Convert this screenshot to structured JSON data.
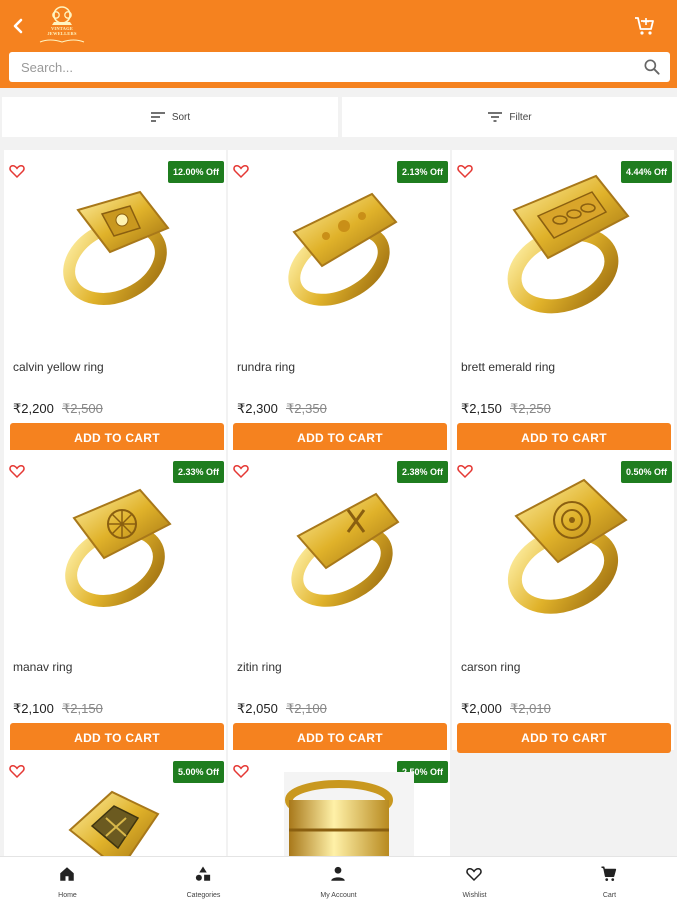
{
  "app": {
    "logo_text": [
      "VINTAGE",
      "JEWELLERS"
    ]
  },
  "search": {
    "placeholder": "Search..."
  },
  "toolbar": {
    "sort_label": "Sort",
    "filter_label": "Filter"
  },
  "colors": {
    "primary": "#f5821f",
    "discount_badge": "#1f7d1f",
    "heart": "#e53935",
    "gold": "#e0b22a"
  },
  "products": [
    {
      "name": "calvin yellow ring",
      "price": "₹2,200",
      "mrp": "₹2,500",
      "discount": "12.00% Off",
      "button": "ADD TO CART"
    },
    {
      "name": "rundra ring",
      "price": "₹2,300",
      "mrp": "₹2,350",
      "discount": "2.13% Off",
      "button": "ADD TO CART"
    },
    {
      "name": "brett emerald ring",
      "price": "₹2,150",
      "mrp": "₹2,250",
      "discount": "4.44% Off",
      "button": "ADD TO CART"
    },
    {
      "name": "manav ring",
      "price": "₹2,100",
      "mrp": "₹2,150",
      "discount": "2.33% Off",
      "button": "ADD TO CART"
    },
    {
      "name": "zitin ring",
      "price": "₹2,050",
      "mrp": "₹2,100",
      "discount": "2.38% Off",
      "button": "ADD TO CART"
    },
    {
      "name": "carson ring",
      "price": "₹2,000",
      "mrp": "₹2,010",
      "discount": "0.50% Off",
      "button": "ADD TO CART"
    },
    {
      "name": "",
      "price": "",
      "mrp": "",
      "discount": "5.00% Off",
      "button": ""
    },
    {
      "name": "",
      "price": "",
      "mrp": "",
      "discount": "2.50% Off",
      "button": ""
    }
  ],
  "bottom_nav": [
    {
      "label": "Home",
      "icon": "home-icon"
    },
    {
      "label": "Categories",
      "icon": "categories-icon"
    },
    {
      "label": "My Account",
      "icon": "account-icon"
    },
    {
      "label": "Wishlist",
      "icon": "heart-icon"
    },
    {
      "label": "Cart",
      "icon": "cart-icon"
    }
  ]
}
